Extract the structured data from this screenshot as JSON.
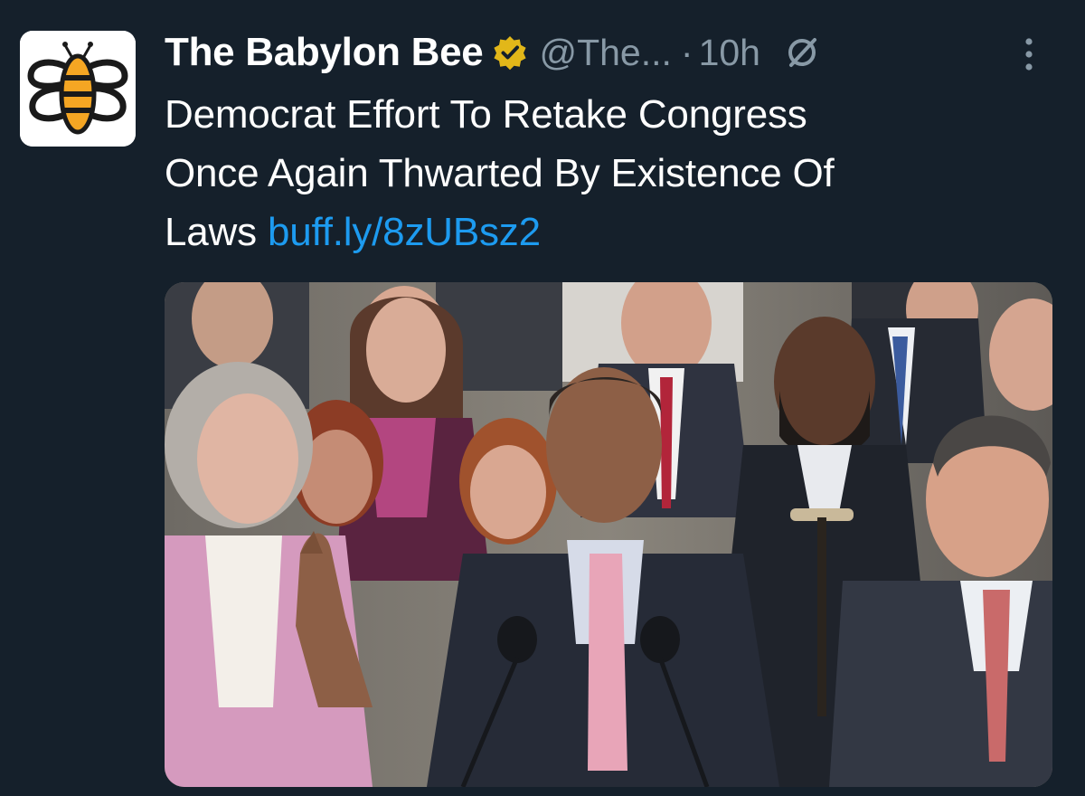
{
  "tweet": {
    "author": {
      "display_name": "The Babylon Bee",
      "handle": "@The...",
      "verified_badge": "gold-verified-icon",
      "avatar": "babylon-bee-logo"
    },
    "separator": "·",
    "timestamp": "10h",
    "text_lines": [
      "Democrat Effort To Retake Congress",
      "Once Again Thwarted By Existence Of",
      "Laws"
    ],
    "link": "buff.ly/8zUBsz2",
    "media": {
      "kind": "photo",
      "description_icon": "press-conference-photo"
    },
    "icons": {
      "grok": "grok-icon",
      "more": "more-vertical-icon"
    }
  },
  "colors": {
    "background": "#15202b",
    "text": "#ffffff",
    "secondary_text": "#8899a6",
    "link": "#1d9bf0",
    "verified_gold": "#e2b719",
    "bee_orange": "#f5a623"
  }
}
